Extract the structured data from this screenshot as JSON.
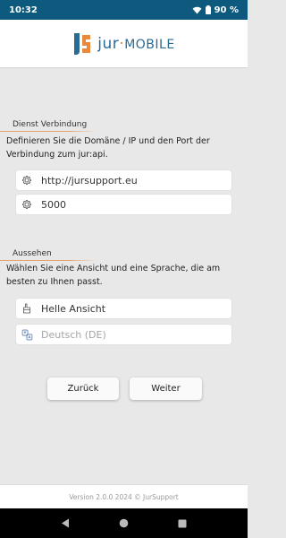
{
  "status_bar": {
    "time": "10:32",
    "battery": "90 %"
  },
  "header": {
    "logo_prefix": "jur",
    "logo_separator": "·",
    "logo_suffix": "mobile"
  },
  "service": {
    "title": "Dienst Verbindung",
    "description": "Definieren Sie die Domäne / IP und den Port der Verbindung zum jur:api.",
    "host_value": "http://jursupport.eu",
    "port_value": "5000"
  },
  "appearance": {
    "title": "Aussehen",
    "description": "Wählen Sie eine Ansicht und eine Sprache, die am besten zu Ihnen passt.",
    "theme_value": "Helle Ansicht",
    "language_value": "Deutsch (DE)"
  },
  "buttons": {
    "back_label": "Zurück",
    "next_label": "Weiter"
  },
  "footer": {
    "version_text": "Version 2.0.0 2024 © JurSupport"
  },
  "colors": {
    "status_bar": "#0d5a7e",
    "accent_line": "#e9a26a",
    "logo_blue": "#2a6b94",
    "logo_orange": "#e8893b",
    "background": "#e8e8e8"
  },
  "icons": {
    "host": "gear-icon",
    "port": "gear-icon",
    "theme": "brush-icon",
    "language": "translate-icon"
  }
}
